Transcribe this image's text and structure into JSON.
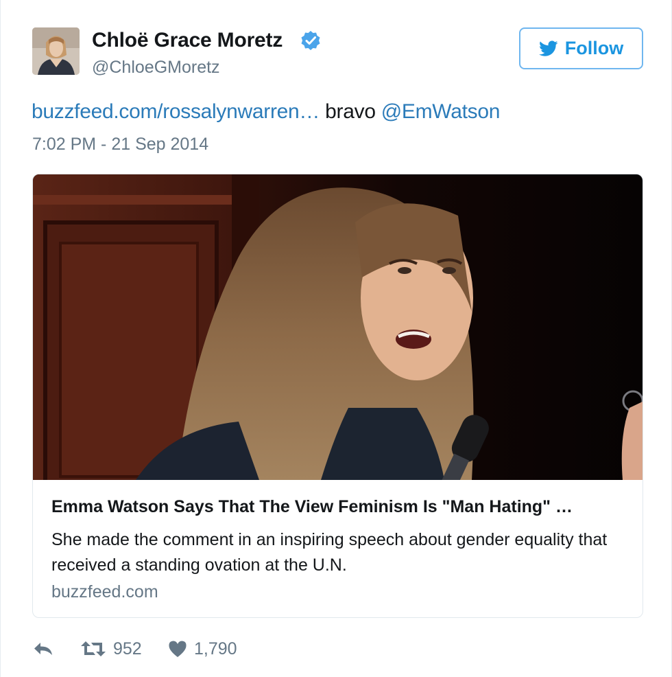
{
  "author": {
    "display_name": "Chloë Grace Moretz",
    "handle": "@ChloeGMoretz",
    "verified": true,
    "avatar_icon": "profile-photo"
  },
  "follow_button": {
    "label": "Follow",
    "icon": "twitter-bird-icon"
  },
  "tweet": {
    "link_text": "buzzfeed.com/rossalynwarren…",
    "middle_text": " bravo ",
    "mention": "@EmWatson",
    "timestamp": "7:02 PM - 21 Sep 2014"
  },
  "card": {
    "title": "Emma Watson Says That The View Feminism Is \"Man Hating\" …",
    "description": "She made the comment in an inspiring speech about gender equality that received a standing ovation at the U.N.",
    "domain": "buzzfeed.com"
  },
  "actions": {
    "reply_icon": "reply-icon",
    "retweet_count": "952",
    "like_count": "1,790"
  },
  "colors": {
    "link": "#2b7bb9",
    "follow_blue": "#1b95e0",
    "verified_blue": "#4ba4ea",
    "muted": "#657786"
  }
}
